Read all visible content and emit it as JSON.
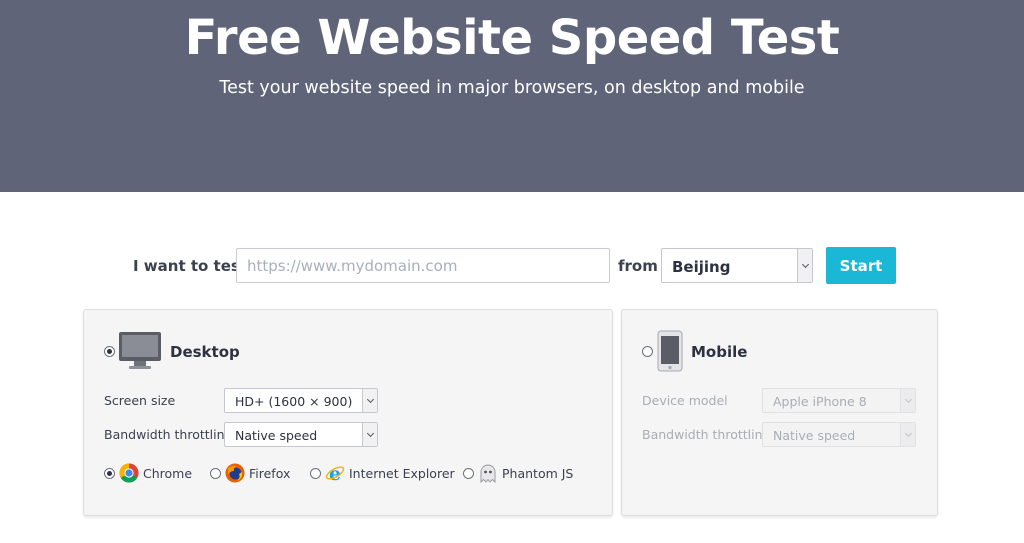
{
  "hero": {
    "title": "Free Website Speed Test",
    "subtitle": "Test your website speed in major browsers, on desktop and mobile"
  },
  "test_form": {
    "i_want_label": "I want to test",
    "url_value": "",
    "url_placeholder": "https://www.mydomain.com",
    "from_label": "from",
    "location_value": "Beijing",
    "start_label": "Start"
  },
  "desktop": {
    "title": "Desktop",
    "selected": true,
    "screen_size_label": "Screen size",
    "screen_size_value": "HD+ (1600 × 900)",
    "bandwidth_label": "Bandwidth throttling",
    "bandwidth_value": "Native speed",
    "browsers": [
      {
        "label": "Chrome",
        "icon": "chrome-icon",
        "selected": true
      },
      {
        "label": "Firefox",
        "icon": "firefox-icon",
        "selected": false
      },
      {
        "label": "Internet Explorer",
        "icon": "internet-explorer-icon",
        "selected": false
      },
      {
        "label": "Phantom JS",
        "icon": "phantomjs-ghost-icon",
        "selected": false
      }
    ]
  },
  "mobile": {
    "title": "Mobile",
    "selected": false,
    "device_model_label": "Device model",
    "device_model_value": "Apple iPhone 8",
    "bandwidth_label": "Bandwidth throttling",
    "bandwidth_value": "Native speed"
  },
  "colors": {
    "hero_bg": "#606478",
    "accent": "#1ab8d6",
    "panel_bg": "#f5f5f6"
  }
}
